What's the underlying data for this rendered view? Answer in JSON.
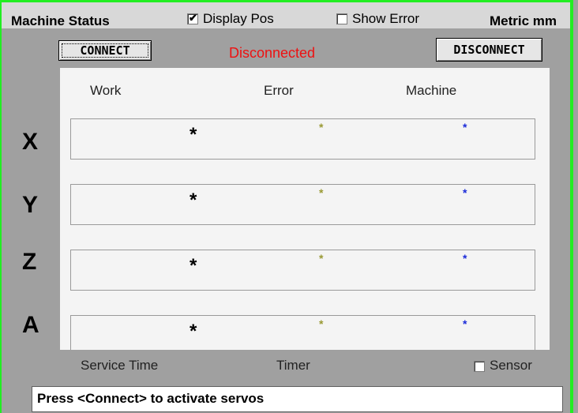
{
  "header": {
    "title": "Machine Status",
    "display_pos": {
      "label": "Display Pos",
      "checked": true
    },
    "show_error": {
      "label": "Show Error",
      "checked": false
    },
    "units": "Metric mm"
  },
  "controls": {
    "connect_label": "CONNECT",
    "disconnect_label": "DISCONNECT",
    "status": "Disconnected",
    "status_color": "#ee1111"
  },
  "columns": {
    "work": "Work",
    "error": "Error",
    "machine": "Machine"
  },
  "axes": [
    {
      "name": "X",
      "work": "*",
      "error": "*",
      "machine": "*"
    },
    {
      "name": "Y",
      "work": "*",
      "error": "*",
      "machine": "*"
    },
    {
      "name": "Z",
      "work": "*",
      "error": "*",
      "machine": "*"
    },
    {
      "name": "A",
      "work": "*",
      "error": "*",
      "machine": "*"
    }
  ],
  "footer": {
    "service_time": "Service Time",
    "timer": "Timer",
    "sensor": {
      "label": "Sensor",
      "checked": false
    }
  },
  "message": "Press <Connect> to activate servos",
  "colors": {
    "frame_border": "#22ee22",
    "background": "#a0a0a0",
    "error_value": "#999933",
    "machine_value": "#1b2bd9"
  }
}
